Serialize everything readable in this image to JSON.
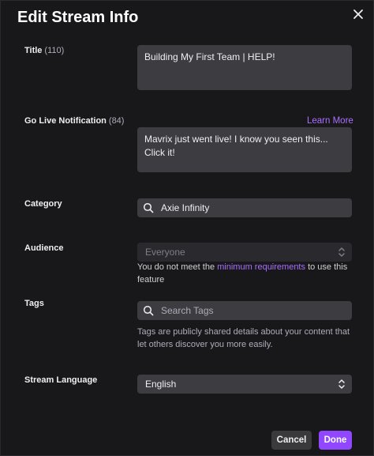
{
  "dialog": {
    "title": "Edit Stream Info"
  },
  "stream_title": {
    "label": "Title",
    "count": "(110)",
    "value": "Building My First Team | HELP!"
  },
  "notification": {
    "label": "Go Live Notification",
    "count": "(84)",
    "learn_more": "Learn More",
    "value": "Mavrix just went live! I know you seen this... Click it!"
  },
  "category": {
    "label": "Category",
    "value": "Axie Infinity"
  },
  "audience": {
    "label": "Audience",
    "value": "Everyone",
    "help_prefix": "You do not meet the",
    "help_link": "minimum requirements",
    "help_suffix": "to use this feature"
  },
  "tags": {
    "label": "Tags",
    "placeholder": "Search Tags",
    "help": "Tags are publicly shared details about your content that let others discover you more easily."
  },
  "language": {
    "label": "Stream Language",
    "value": "English"
  },
  "footer": {
    "cancel_label": "Cancel",
    "done_label": "Done"
  },
  "colors": {
    "accent": "#9147ff",
    "link": "#a970ff",
    "background": "#18181b",
    "field": "#3c3c41"
  }
}
